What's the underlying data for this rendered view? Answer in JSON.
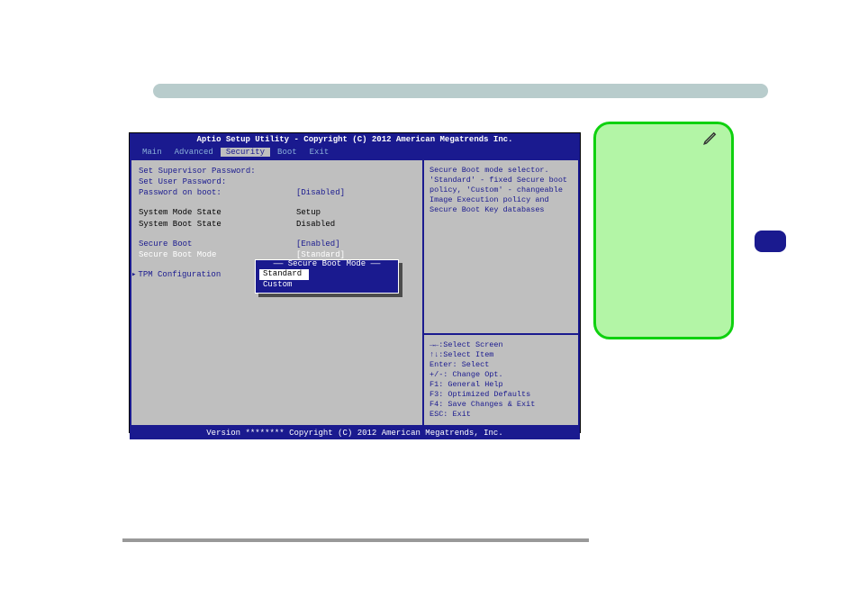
{
  "bios": {
    "title": "Aptio Setup Utility - Copyright (C) 2012 American Megatrends Inc.",
    "footer": "Version ******** Copyright (C) 2012 American Megatrends, Inc.",
    "tabs": {
      "main": "Main",
      "advanced": "Advanced",
      "security": "Security",
      "boot": "Boot",
      "exit": "Exit"
    },
    "left": {
      "supervisor_label": "Set Supervisor Password:",
      "user_label": "Set User Password:",
      "pwd_on_boot_label": "Password on boot:",
      "pwd_on_boot_value": "[Disabled]",
      "sys_mode_label": "System Mode State",
      "sys_mode_value": "Setup",
      "sys_boot_label": "System Boot State",
      "sys_boot_value": "Disabled",
      "secure_boot_label": "Secure Boot",
      "secure_boot_value": "[Enabled]",
      "secure_mode_label": "Secure Boot Mode",
      "secure_mode_value": "[Standard]",
      "tpm_label": "TPM Configuration"
    },
    "popup": {
      "title": "Secure Boot Mode",
      "opt1": "Standard",
      "opt2": "Custom"
    },
    "help_top": "Secure Boot mode selector. 'Standard' - fixed Secure boot policy, 'Custom' - changeable Image Execution policy and Secure Boot Key databases",
    "help_bottom": {
      "l1": "→←:Select Screen",
      "l2": "↑↓:Select Item",
      "l3": "Enter: Select",
      "l4": "+/-: Change Opt.",
      "l5": "F1: General Help",
      "l6": "F3: Optimized Defaults",
      "l7": "F4: Save Changes & Exit",
      "l8": "ESC: Exit"
    }
  }
}
